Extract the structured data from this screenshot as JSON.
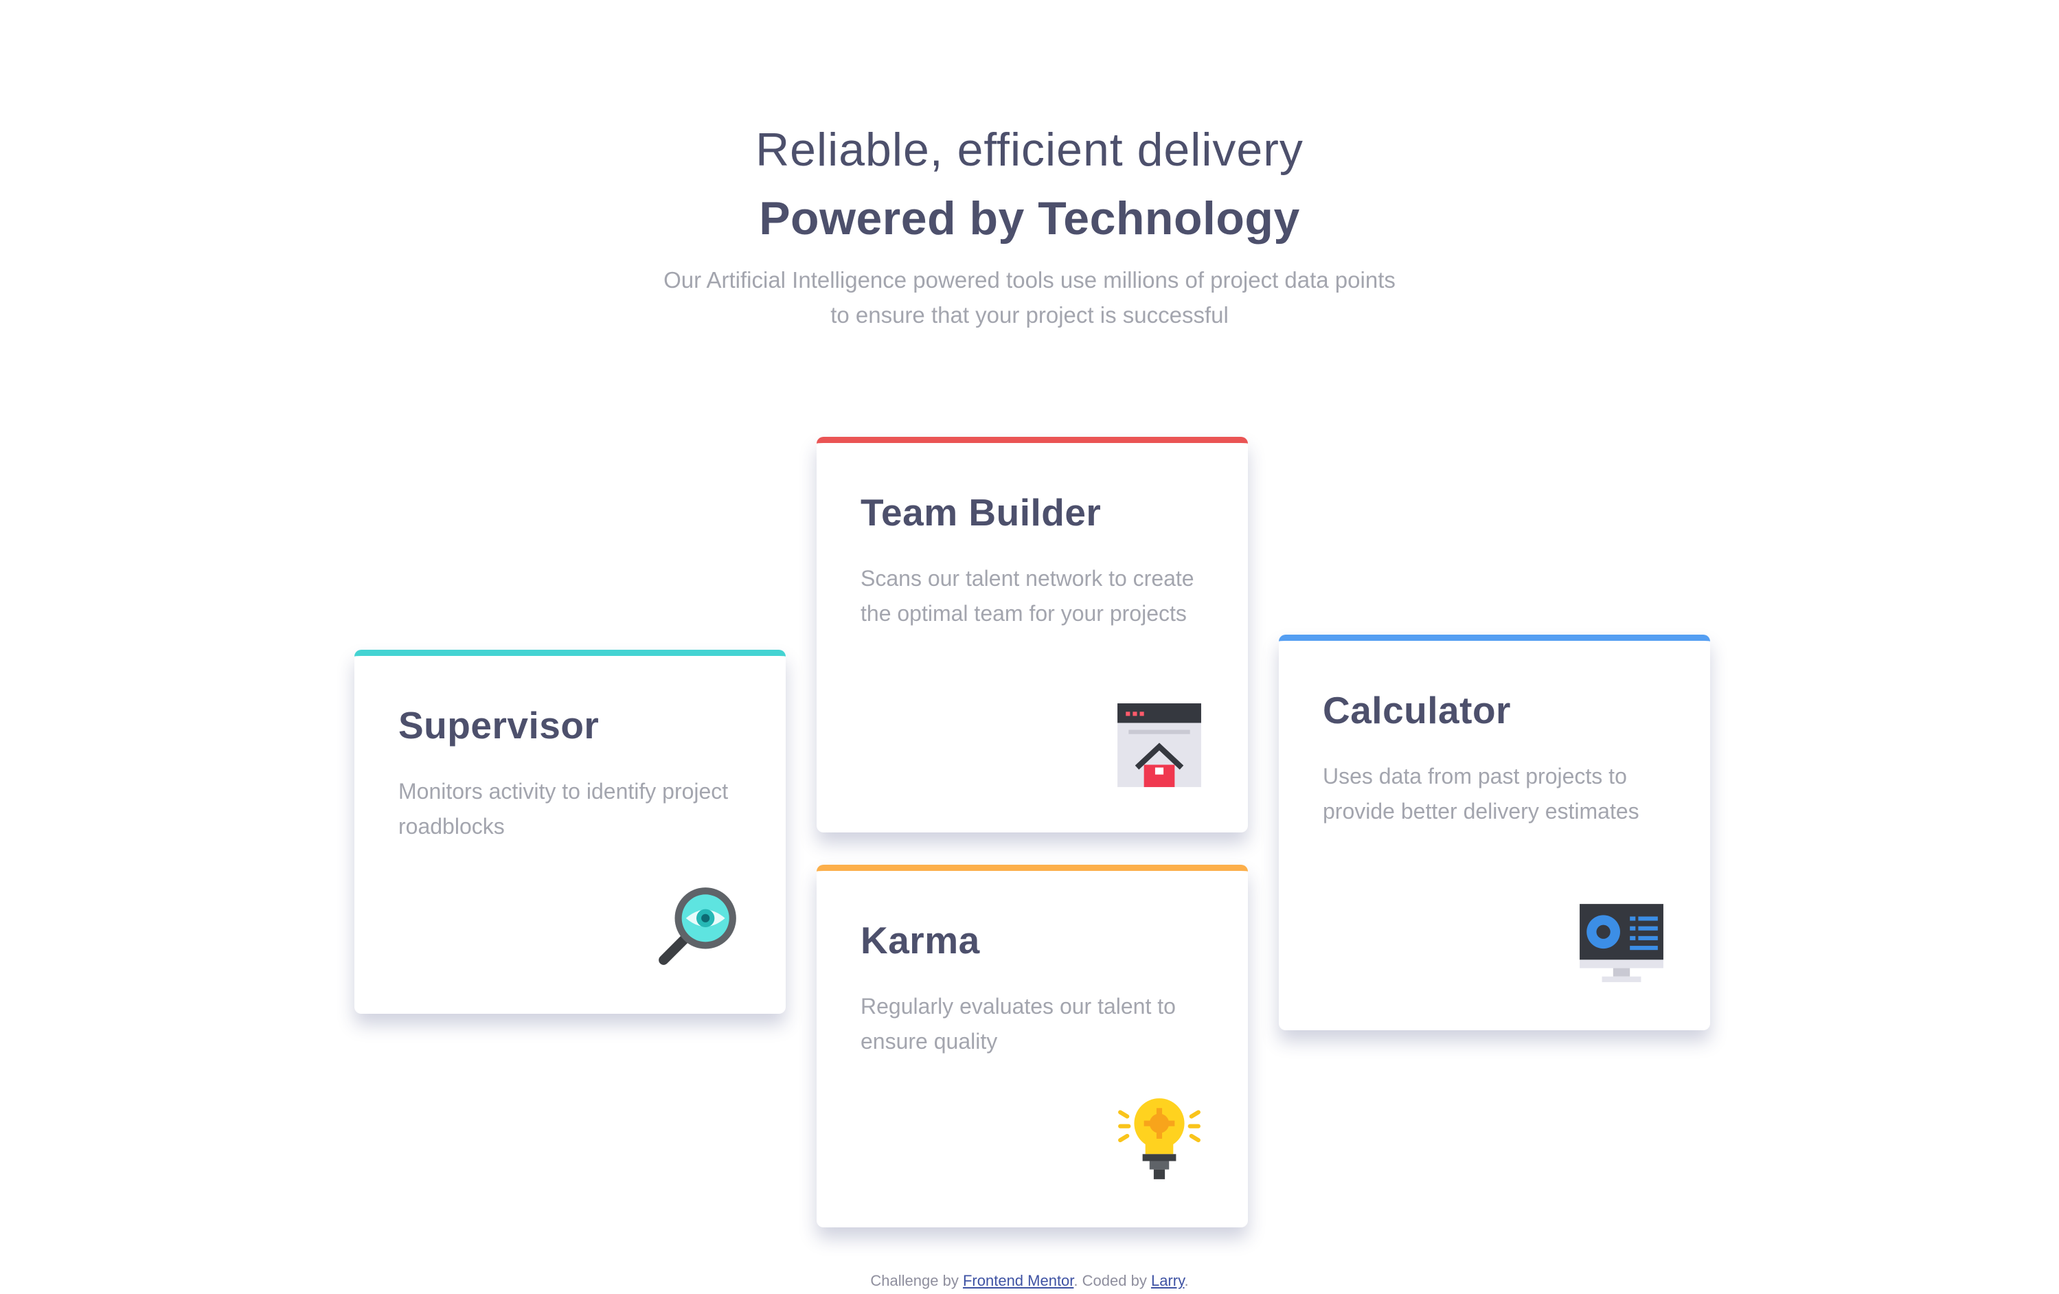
{
  "header": {
    "subtitle": "Reliable, efficient delivery",
    "title": "Powered by Technology",
    "desc_line1": "Our Artificial Intelligence powered tools use millions of project data points",
    "desc_line2": "to ensure that your project is successful"
  },
  "cards": {
    "supervisor": {
      "title": "Supervisor",
      "text": "Monitors activity to identify project roadblocks",
      "icon": "magnifier-eye-icon",
      "accent": "#44d3d2"
    },
    "team": {
      "title": "Team Builder",
      "text": "Scans our talent network to create the optimal team for your projects",
      "icon": "browser-house-icon",
      "accent": "#ea5454"
    },
    "karma": {
      "title": "Karma",
      "text": "Regularly evaluates our talent to ensure quality",
      "icon": "lightbulb-icon",
      "accent": "#fcaf4a"
    },
    "calculator": {
      "title": "Calculator",
      "text": "Uses data from past projects to provide better delivery estimates",
      "icon": "monitor-chart-icon",
      "accent": "#549ef2"
    }
  },
  "footer": {
    "prefix": "Challenge by",
    "link1": "Frontend Mentor",
    "middle": ". Coded by",
    "link2": "Larry",
    "suffix": "."
  }
}
